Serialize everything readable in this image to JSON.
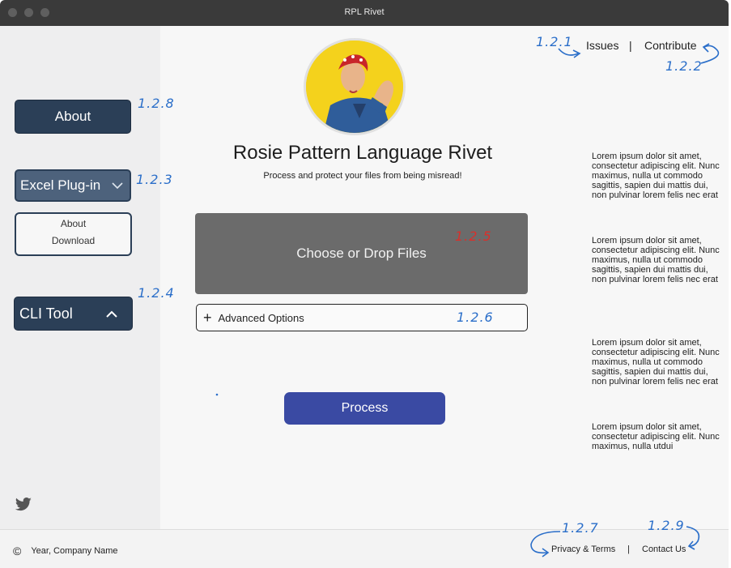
{
  "window": {
    "title": "RPL Rivet"
  },
  "sidebar": {
    "about_label": "About",
    "excel_label": "Excel Plug-in",
    "excel_items": [
      "About",
      "Download"
    ],
    "cli_label": "CLI Tool"
  },
  "main": {
    "app_title": "Rosie Pattern Language Rivet",
    "app_subtitle": "Process and protect your files from being misread!",
    "dropzone_label": "Choose or Drop Files",
    "advanced_label": "Advanced Options",
    "process_label": "Process"
  },
  "top_links": {
    "issues": "Issues",
    "separator": "|",
    "contribute": "Contribute"
  },
  "lorem_blocks": [
    "Lorem ipsum dolor sit amet, consectetur adipiscing elit. Nunc maximus, nulla ut commodo sagittis, sapien dui mattis dui, non pulvinar lorem felis nec erat",
    "Lorem ipsum dolor sit amet, consectetur adipiscing elit. Nunc maximus, nulla ut commodo sagittis, sapien dui mattis dui, non pulvinar lorem felis nec erat",
    "Lorem ipsum dolor sit amet, consectetur adipiscing elit. Nunc maximus, nulla ut commodo sagittis, sapien dui mattis dui, non pulvinar lorem felis nec erat",
    "Lorem ipsum dolor sit amet, consectetur adipiscing elit. Nunc maximus, nulla utdui"
  ],
  "footer": {
    "copyright_symbol": "©",
    "copyright_text": "Year, Company Name",
    "privacy_label": "Privacy & Terms",
    "separator": "|",
    "contact_label": "Contact Us"
  },
  "annotations": {
    "a121": "1.2.1",
    "a122": "1.2.2",
    "a128": "1.2.8",
    "a123": "1.2.3",
    "a124": "1.2.4",
    "a125": "1.2.5",
    "a126": "1.2.6",
    "a127": "1.2.7",
    "a129": "1.2.9"
  },
  "colors": {
    "sidebar_button": "#2b3f57",
    "process_button": "#3a4aa3",
    "dropzone": "#6b6b6b",
    "annotation_blue": "#2a6ec9",
    "annotation_red": "#d9302b"
  },
  "icons": {
    "twitter": "twitter-icon",
    "chevron_down": "chevron-down-icon",
    "chevron_up": "chevron-up-icon",
    "plus": "plus-icon",
    "copyright": "copyright-icon"
  }
}
